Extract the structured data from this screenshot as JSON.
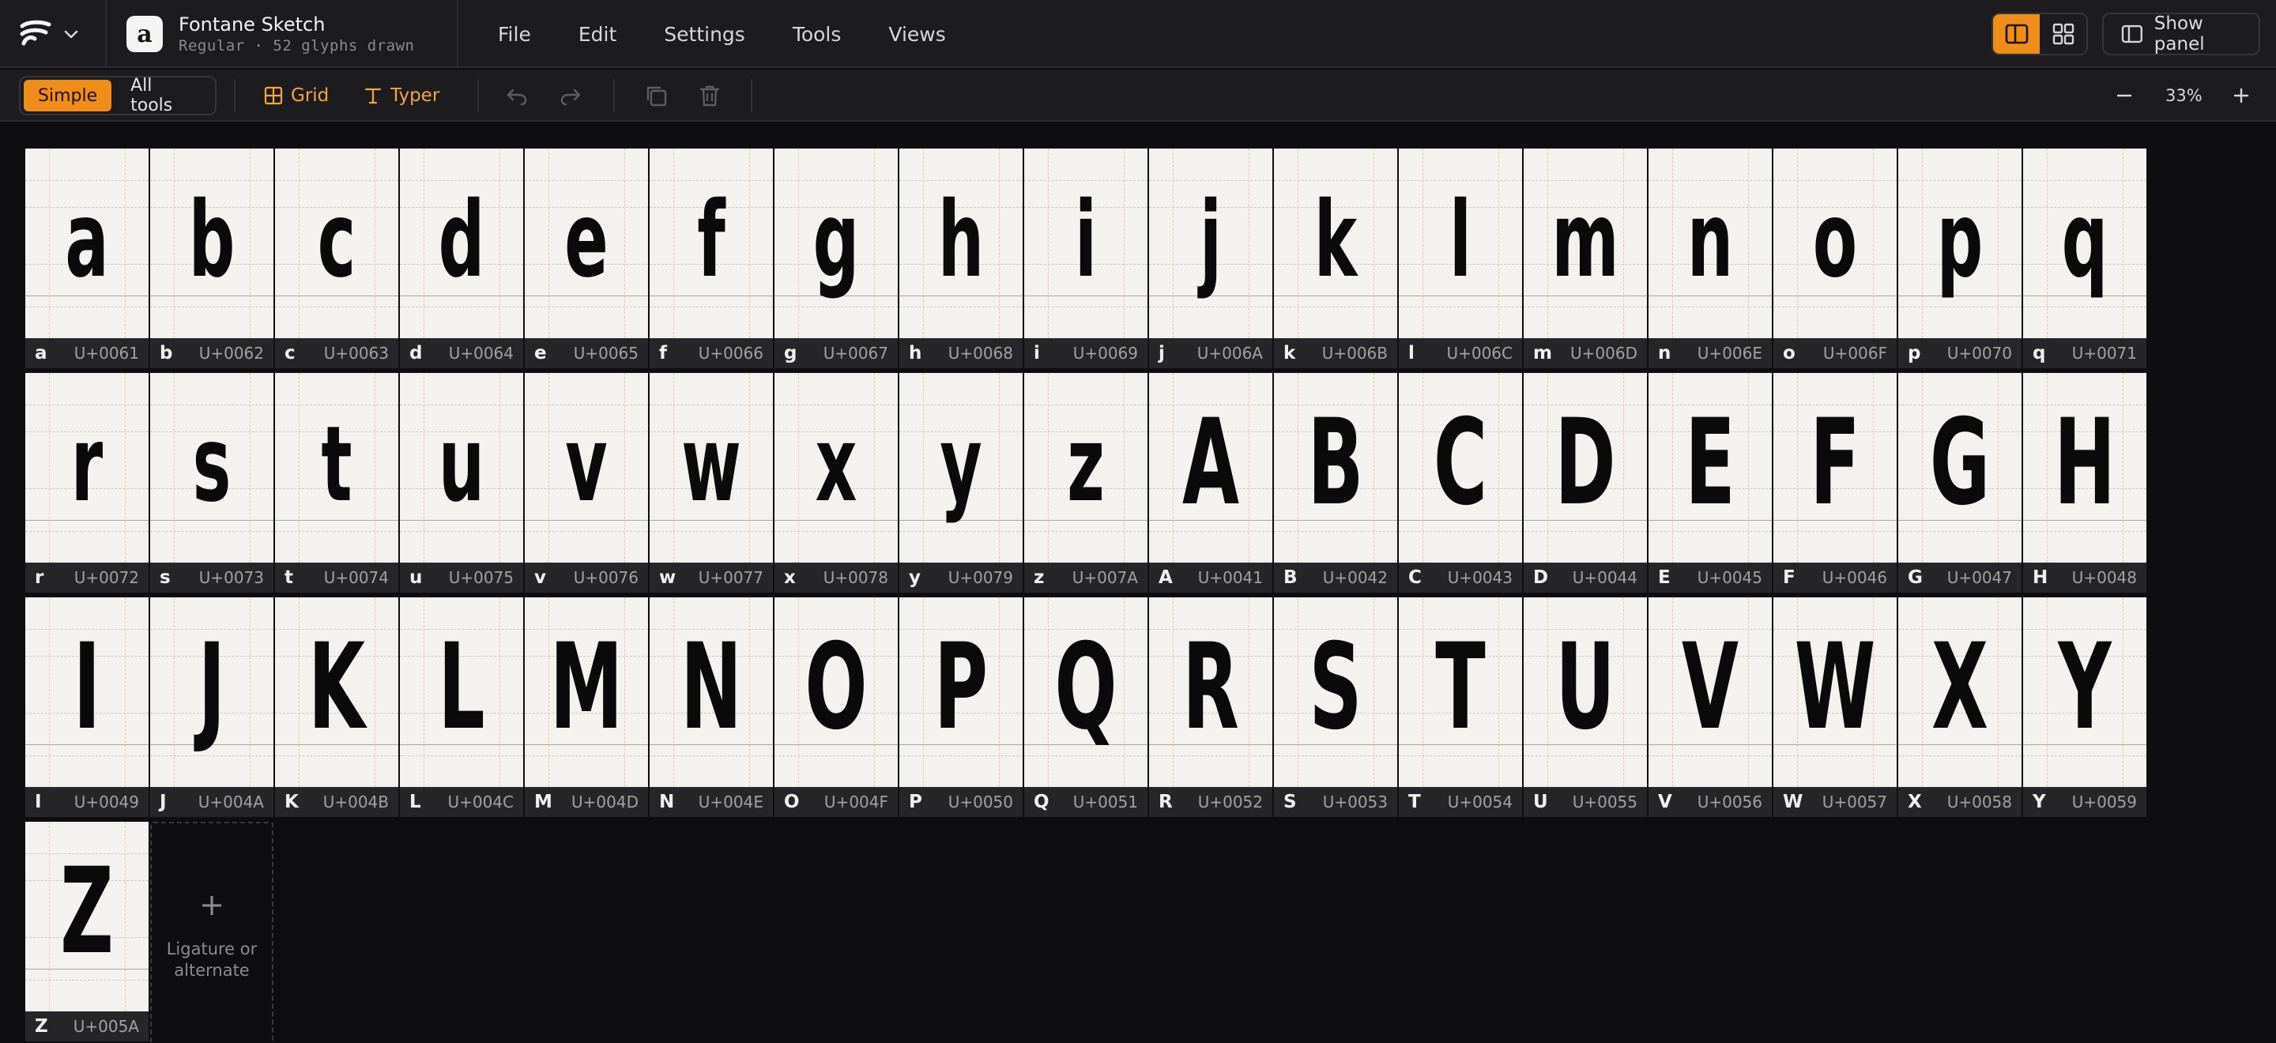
{
  "app": {
    "menu_items": [
      "File",
      "Edit",
      "Settings",
      "Tools",
      "Views"
    ],
    "show_panel_label": "Show panel"
  },
  "document": {
    "icon_letter": "a",
    "title": "Fontane Sketch",
    "subtitle": "Regular · 52 glyphs drawn"
  },
  "toolbar": {
    "mode_simple": "Simple",
    "mode_all": "All tools",
    "grid_label": "Grid",
    "typer_label": "Typer",
    "zoom_level": "33%",
    "accent_color": "#f08c18"
  },
  "glyphs": [
    {
      "char": "a",
      "code": "U+0061"
    },
    {
      "char": "b",
      "code": "U+0062"
    },
    {
      "char": "c",
      "code": "U+0063"
    },
    {
      "char": "d",
      "code": "U+0064"
    },
    {
      "char": "e",
      "code": "U+0065"
    },
    {
      "char": "f",
      "code": "U+0066"
    },
    {
      "char": "g",
      "code": "U+0067"
    },
    {
      "char": "h",
      "code": "U+0068"
    },
    {
      "char": "i",
      "code": "U+0069"
    },
    {
      "char": "j",
      "code": "U+006A"
    },
    {
      "char": "k",
      "code": "U+006B"
    },
    {
      "char": "l",
      "code": "U+006C"
    },
    {
      "char": "m",
      "code": "U+006D"
    },
    {
      "char": "n",
      "code": "U+006E"
    },
    {
      "char": "o",
      "code": "U+006F"
    },
    {
      "char": "p",
      "code": "U+0070"
    },
    {
      "char": "q",
      "code": "U+0071"
    },
    {
      "char": "r",
      "code": "U+0072"
    },
    {
      "char": "s",
      "code": "U+0073"
    },
    {
      "char": "t",
      "code": "U+0074"
    },
    {
      "char": "u",
      "code": "U+0075"
    },
    {
      "char": "v",
      "code": "U+0076"
    },
    {
      "char": "w",
      "code": "U+0077"
    },
    {
      "char": "x",
      "code": "U+0078"
    },
    {
      "char": "y",
      "code": "U+0079"
    },
    {
      "char": "z",
      "code": "U+007A"
    },
    {
      "char": "A",
      "code": "U+0041"
    },
    {
      "char": "B",
      "code": "U+0042"
    },
    {
      "char": "C",
      "code": "U+0043"
    },
    {
      "char": "D",
      "code": "U+0044"
    },
    {
      "char": "E",
      "code": "U+0045"
    },
    {
      "char": "F",
      "code": "U+0046"
    },
    {
      "char": "G",
      "code": "U+0047"
    },
    {
      "char": "H",
      "code": "U+0048"
    },
    {
      "char": "I",
      "code": "U+0049"
    },
    {
      "char": "J",
      "code": "U+004A"
    },
    {
      "char": "K",
      "code": "U+004B"
    },
    {
      "char": "L",
      "code": "U+004C"
    },
    {
      "char": "M",
      "code": "U+004D"
    },
    {
      "char": "N",
      "code": "U+004E"
    },
    {
      "char": "O",
      "code": "U+004F"
    },
    {
      "char": "P",
      "code": "U+0050"
    },
    {
      "char": "Q",
      "code": "U+0051"
    },
    {
      "char": "R",
      "code": "U+0052"
    },
    {
      "char": "S",
      "code": "U+0053"
    },
    {
      "char": "T",
      "code": "U+0054"
    },
    {
      "char": "U",
      "code": "U+0055"
    },
    {
      "char": "V",
      "code": "U+0056"
    },
    {
      "char": "W",
      "code": "U+0057"
    },
    {
      "char": "X",
      "code": "U+0058"
    },
    {
      "char": "Y",
      "code": "U+0059"
    },
    {
      "char": "Z",
      "code": "U+005A"
    }
  ],
  "add_cell": {
    "label": "Ligature or alternate"
  }
}
